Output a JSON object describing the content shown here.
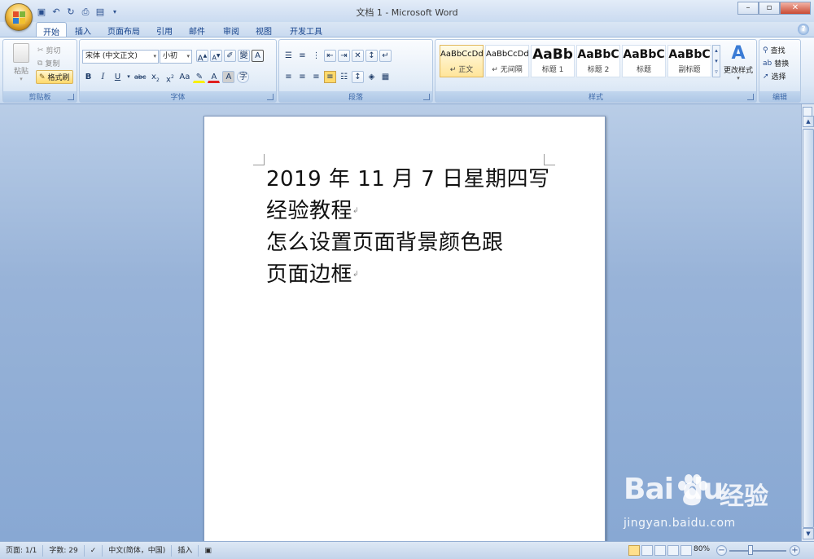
{
  "window": {
    "title": "文档 1 - Microsoft Word"
  },
  "tabs": [
    "开始",
    "插入",
    "页面布局",
    "引用",
    "邮件",
    "审阅",
    "视图",
    "开发工具"
  ],
  "clipboard": {
    "paste_label": "粘贴",
    "cut_label": "剪切",
    "copy_label": "复制",
    "format_painter_label": "格式刷",
    "group_label": "剪贴板"
  },
  "font": {
    "font_name": "宋体 (中文正文)",
    "font_size": "小初",
    "group_label": "字体"
  },
  "paragraph": {
    "group_label": "段落"
  },
  "styles": {
    "items": [
      {
        "preview": "AaBbCcDd",
        "label": "↵ 正文"
      },
      {
        "preview": "AaBbCcDd",
        "label": "↵ 无间隔"
      },
      {
        "preview": "AaBb",
        "label": "标题 1"
      },
      {
        "preview": "AaBbC",
        "label": "标题 2"
      },
      {
        "preview": "AaBbC",
        "label": "标题"
      },
      {
        "preview": "AaBbC",
        "label": "副标题"
      }
    ],
    "change_styles_label": "更改样式",
    "group_label": "样式"
  },
  "editing": {
    "find_label": "查找",
    "replace_label": "替换",
    "select_label": "选择",
    "group_label": "编辑"
  },
  "document": {
    "lines": [
      "2019 年 11 月 7 日星期四写",
      "经验教程",
      "怎么设置页面背景颜色跟",
      "页面边框"
    ]
  },
  "status": {
    "page": "页面: 1/1",
    "words": "字数: 29",
    "language": "中文(简体，中国)",
    "mode": "插入",
    "zoom": "80%"
  },
  "watermark": {
    "brand_text": "Bai  du",
    "brand_cn": "经验",
    "url": "jingyan.baidu.com"
  },
  "colors": {
    "accent": "#15428b",
    "ribbon_bg": "#dce8f6",
    "workspace_bg": "#98b3d8",
    "selected_style": "#ffe59a"
  }
}
